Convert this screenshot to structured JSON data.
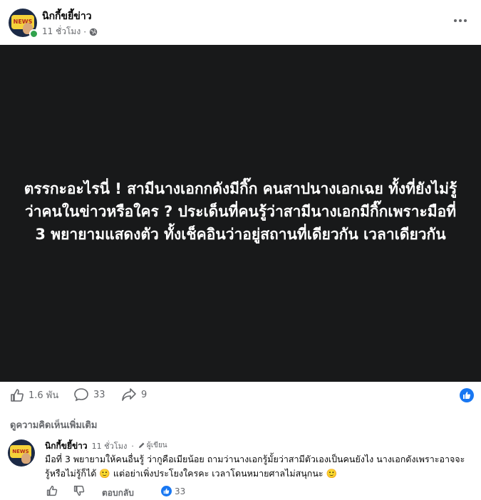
{
  "post": {
    "page_name": "นิกกี้ขยี้ข่าว",
    "time": "11 ชั่วโมง",
    "separator": "·",
    "privacy_icon": "globe-icon",
    "image_text": "ตรรกะอะไรนี่ ! สามีนางเอกกดังมีกิ๊ก คนสาปนางเอกเฉย ทั้งที่ยังไม่รู้ว่าคนในข่าวหรือใคร ? ประเด็นที่คนรู้ว่าสามีนางเอกมีกิ๊กเพราะมือที่ 3 พยายามแสดงตัว ทั้งเช็คอินว่าอยู่สถานที่เดียวกัน เวลาเดียวกัน"
  },
  "actions": {
    "likes": "1.6 พัน",
    "comments": "33",
    "shares": "9"
  },
  "comments_section": {
    "more_comments": "ดูความคิดเห็นเพิ่มเติม"
  },
  "comment": {
    "name": "นิกกี้ขยี้ข่าว",
    "time": "11 ชั่วโมง",
    "separator": "·",
    "author_badge": "ผู้เขียน",
    "text": "มือที่ 3 พยายามให้คนอื่นรู้ ว่ากูคือเมียน้อย ถามว่านางเอกรู้มั้ยว่าสามีตัวเองเป็นคนยังไง นางเอกดังเพราะอาจจะรู้หรือไม่รู้ก็ได้ 🙂 แต่อย่าเพิ่งประโยงใครคะ เวลาโดนหมายศาลไม่สนุกนะ 🙂",
    "reply": "ตอบกลับ",
    "reaction_count": "33"
  },
  "colors": {
    "accent": "#1877f2",
    "image_bg": "#18191a",
    "muted": "#65676b",
    "online": "#31a24c"
  }
}
